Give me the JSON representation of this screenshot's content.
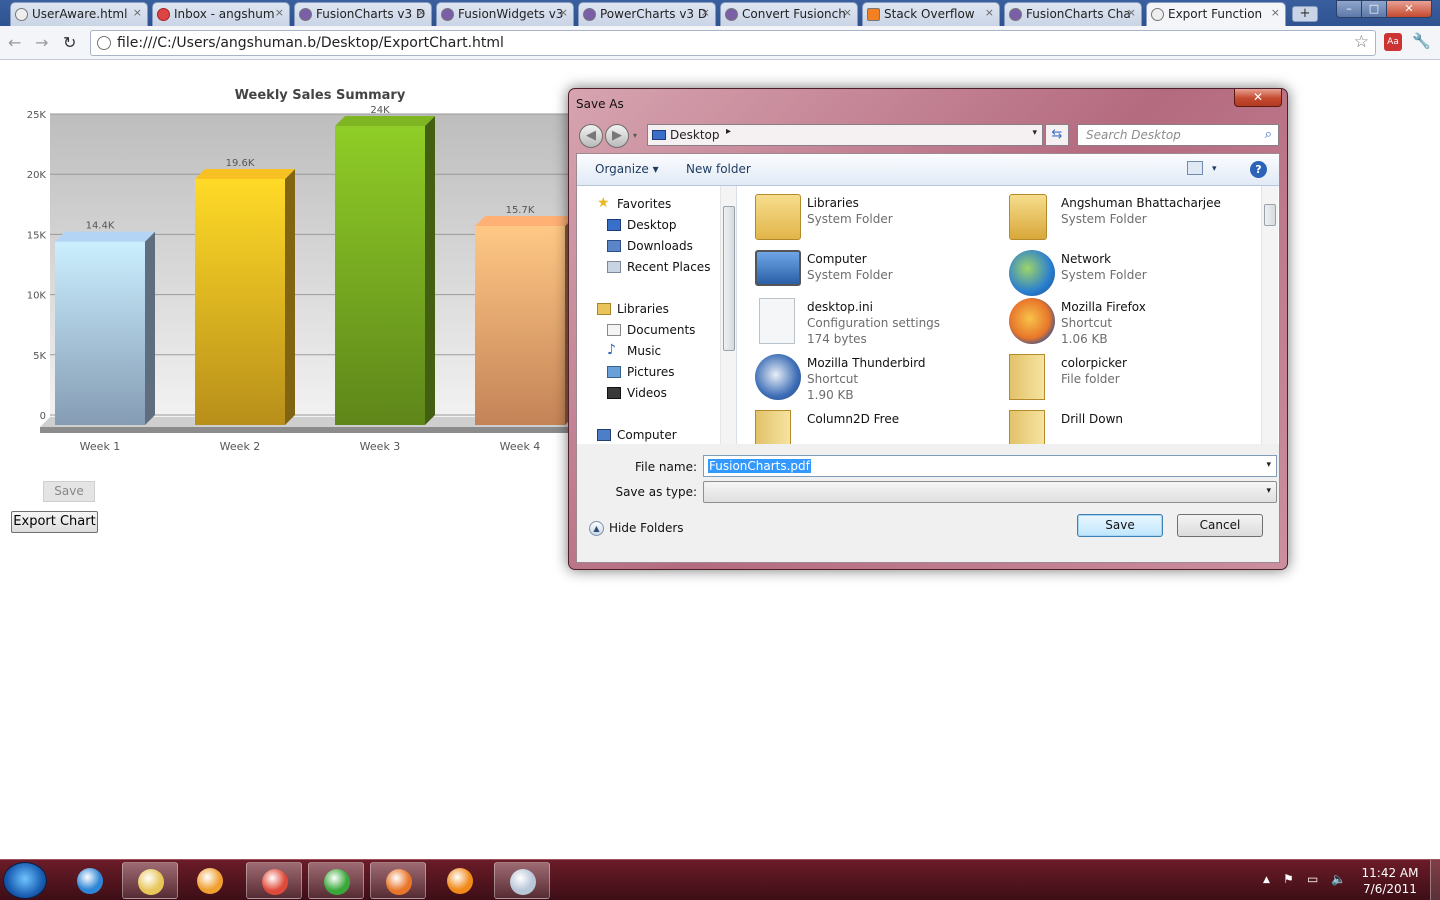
{
  "browser": {
    "tabs": [
      {
        "label": "UserAware.html"
      },
      {
        "label": "Inbox - angshum"
      },
      {
        "label": "FusionCharts v3 D"
      },
      {
        "label": "FusionWidgets v3"
      },
      {
        "label": "PowerCharts v3 D"
      },
      {
        "label": "Convert Fusionch"
      },
      {
        "label": "Stack Overflow"
      },
      {
        "label": "FusionCharts Cha"
      },
      {
        "label": "Export Function"
      }
    ],
    "tab_close": "×",
    "new_tab": "+",
    "window_buttons": {
      "minimize": "–",
      "maximize": "□",
      "close": "✕"
    },
    "url": "file:///C:/Users/angshuman.b/Desktop/ExportChart.html",
    "nav": {
      "back": "←",
      "forward": "→",
      "reload": "↻",
      "star": "☆",
      "wrench": "🔧"
    }
  },
  "page": {
    "save_button": "Save",
    "export_button": "Export Chart"
  },
  "chart_data": {
    "type": "bar",
    "title": "Weekly Sales Summary",
    "categories": [
      "Week 1",
      "Week 2",
      "Week 3",
      "Week 4"
    ],
    "values": [
      14400,
      19600,
      24000,
      15700
    ],
    "value_labels": [
      "14.4K",
      "19.6K",
      "24K",
      "15.7K"
    ],
    "ylim": [
      0,
      25000
    ],
    "y_ticks": [
      0,
      5000,
      10000,
      15000,
      20000,
      25000
    ],
    "y_tick_labels": [
      "0",
      "5K",
      "10K",
      "15K",
      "20K",
      "25K"
    ],
    "grid": true,
    "colors": [
      "#9cb8d4",
      "#d8a81e",
      "#6e9e1e",
      "#e79a66"
    ]
  },
  "dialog": {
    "title": "Save As",
    "close": "✕",
    "address": "Desktop",
    "address_sep": "▸",
    "dropdown": "▾",
    "refresh": "⇆",
    "search_placeholder": "Search Desktop",
    "search_icon": "⌕",
    "organize": "Organize ▾",
    "new_folder": "New folder",
    "view_dd": "▾",
    "help": "?",
    "nav_pane": [
      {
        "label": "Favorites",
        "icon": "star-icon"
      },
      {
        "label": "Desktop",
        "icon": "desktop-icon"
      },
      {
        "label": "Downloads",
        "icon": "downloads-icon"
      },
      {
        "label": "Recent Places",
        "icon": "recent-places-icon"
      },
      {
        "label": "Libraries",
        "icon": "libraries-icon"
      },
      {
        "label": "Documents",
        "icon": "documents-icon"
      },
      {
        "label": "Music",
        "icon": "music-icon"
      },
      {
        "label": "Pictures",
        "icon": "pictures-icon"
      },
      {
        "label": "Videos",
        "icon": "videos-icon"
      },
      {
        "label": "Computer",
        "icon": "computer-icon"
      }
    ],
    "files": [
      {
        "name": "Libraries",
        "type": "System Folder",
        "size": "",
        "icon": "libraries-folder-icon"
      },
      {
        "name": "Angshuman Bhattacharjee",
        "type": "System Folder",
        "size": "",
        "icon": "user-folder-icon"
      },
      {
        "name": "Computer",
        "type": "System Folder",
        "size": "",
        "icon": "computer-icon"
      },
      {
        "name": "Network",
        "type": "System Folder",
        "size": "",
        "icon": "network-icon"
      },
      {
        "name": "desktop.ini",
        "type": "Configuration settings",
        "size": "174 bytes",
        "icon": "settings-file-icon"
      },
      {
        "name": "Mozilla Firefox",
        "type": "Shortcut",
        "size": "1.06 KB",
        "icon": "firefox-icon"
      },
      {
        "name": "Mozilla Thunderbird",
        "type": "Shortcut",
        "size": "1.90 KB",
        "icon": "thunderbird-icon"
      },
      {
        "name": "colorpicker",
        "type": "File folder",
        "size": "",
        "icon": "folder-icon"
      },
      {
        "name": "Column2D Free",
        "type": "",
        "size": "",
        "icon": "folder-icon"
      },
      {
        "name": "Drill Down",
        "type": "",
        "size": "",
        "icon": "folder-icon"
      }
    ],
    "file_name_label": "File name:",
    "file_name_value": "FusionCharts.pdf",
    "save_as_type_label": "Save as type:",
    "save_as_type_value": "",
    "hide_folders": "Hide Folders",
    "hide_icon": "▲",
    "save": "Save",
    "cancel": "Cancel"
  },
  "taskbar": {
    "apps": [
      {
        "name": "internet-explorer-icon",
        "running": false,
        "color": "#2f86d6"
      },
      {
        "name": "windows-explorer-icon",
        "running": true,
        "color": "#e8c65a"
      },
      {
        "name": "media-player-icon",
        "running": false,
        "color": "#f0a030"
      },
      {
        "name": "chrome-icon",
        "running": true,
        "color": "#e04a3a"
      },
      {
        "name": "green-app-icon",
        "running": true,
        "color": "#3aa83a"
      },
      {
        "name": "firefox-icon",
        "running": true,
        "color": "#e8762a"
      },
      {
        "name": "flame-app-icon",
        "running": false,
        "color": "#f08a1a"
      },
      {
        "name": "paint-icon",
        "running": true,
        "color": "#b8c6d8"
      }
    ],
    "tray": {
      "up_arrow": "▲",
      "flag": "⚑",
      "network": "▭",
      "volume": "🔈"
    },
    "time": "11:42 AM",
    "date": "7/6/2011"
  }
}
